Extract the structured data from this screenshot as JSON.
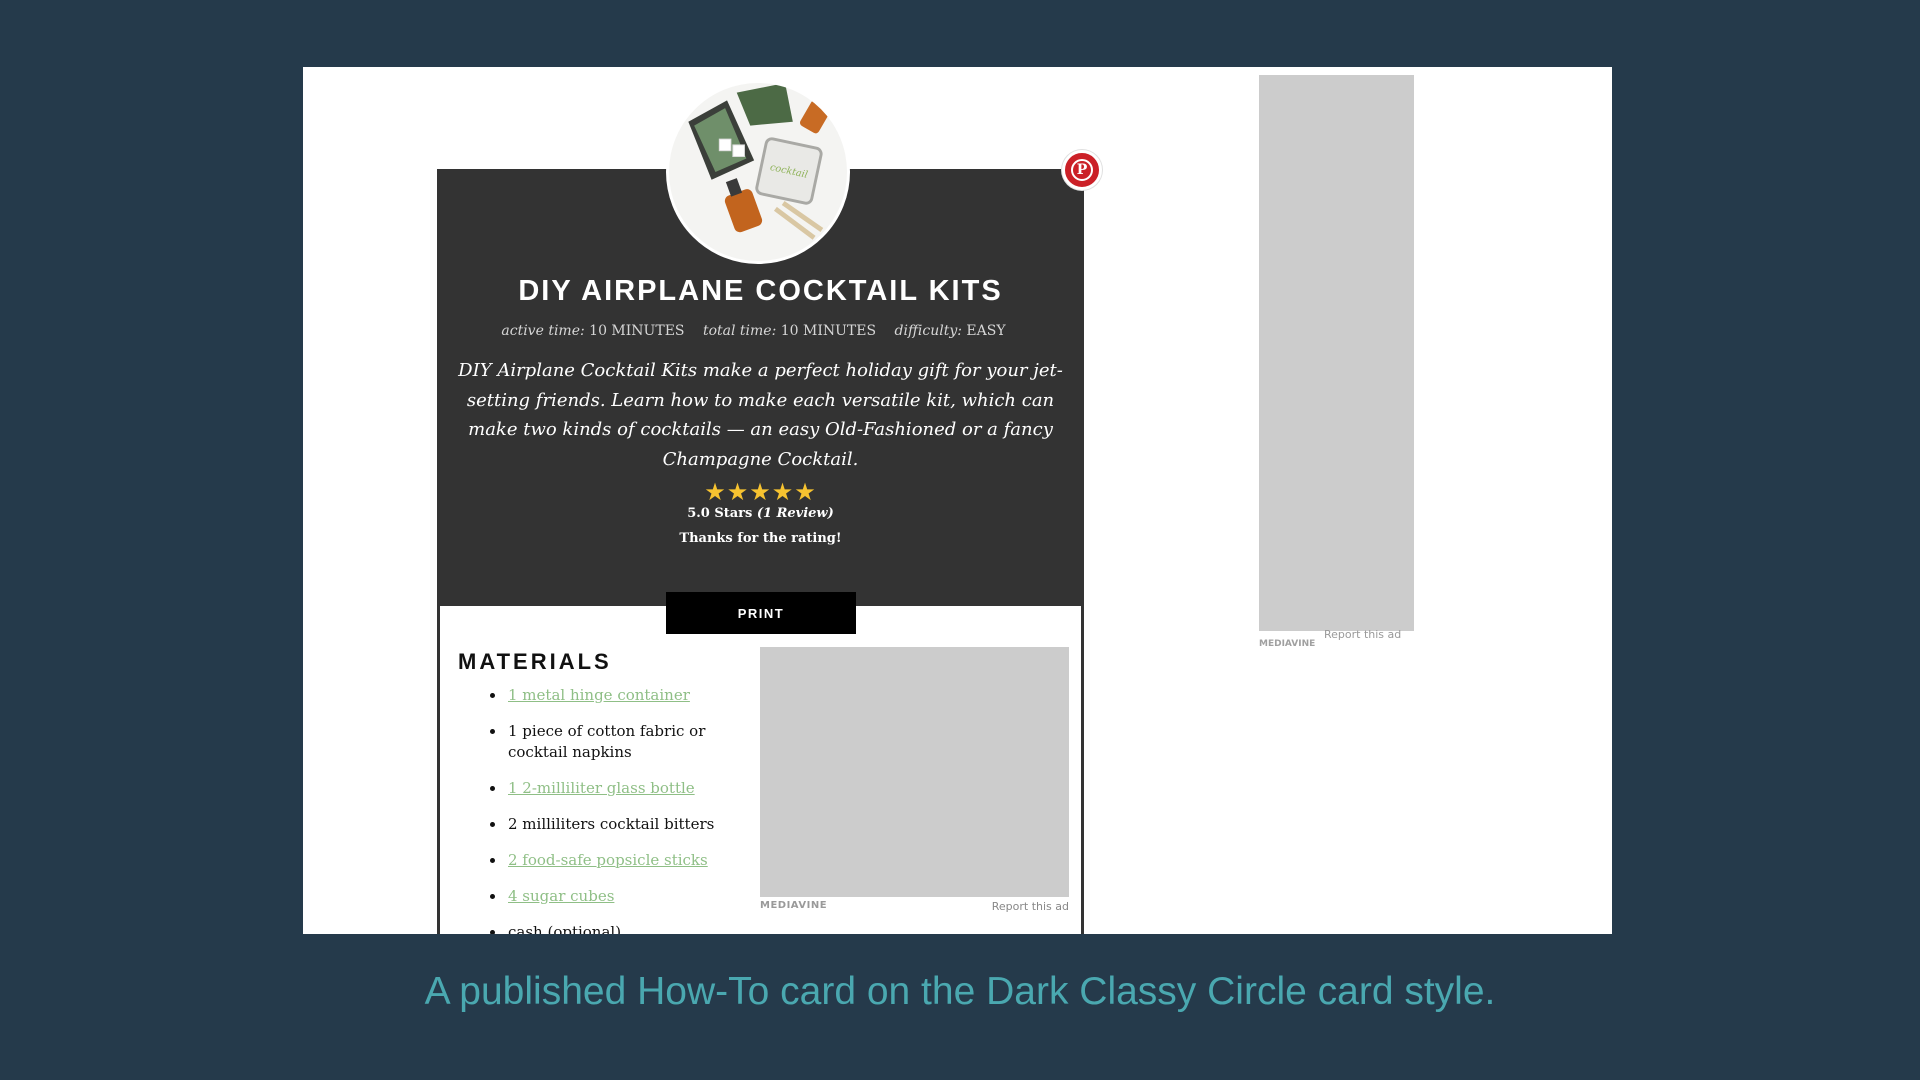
{
  "card": {
    "title": "DIY AIRPLANE COCKTAIL KITS",
    "meta": {
      "active_label": "active time:",
      "active_value": "10 MINUTES",
      "total_label": "total time:",
      "total_value": "10 MINUTES",
      "difficulty_label": "difficulty:",
      "difficulty_value": "EASY"
    },
    "summary": "DIY Airplane Cocktail Kits make a perfect holiday gift for your jet-setting friends. Learn how to make each versatile kit, which can make two kinds of cocktails — an easy Old-Fashioned or a fancy Champagne Cocktail.",
    "stars": "★★★★★",
    "rating": 5,
    "rating_text": "5.0 Stars",
    "review_count": "(1 Review)",
    "thanks": "Thanks for the rating!",
    "print_label": "PRINT",
    "materials_heading": "MATERIALS",
    "materials": [
      {
        "text": "1 metal hinge container",
        "link": true
      },
      {
        "text": "1 piece of cotton fabric or cocktail napkins",
        "link": false
      },
      {
        "text": "1 2-milliliter glass bottle",
        "link": true
      },
      {
        "text": "2 milliliters cocktail bitters",
        "link": false
      },
      {
        "text": "2 food-safe popsicle sticks",
        "link": true
      },
      {
        "text": "4 sugar cubes",
        "link": true
      },
      {
        "text": "cash (optional)",
        "link": false
      }
    ],
    "pin_icon": "pinterest-icon"
  },
  "ads": {
    "inline_brand": "MEDIAVINE",
    "inline_report": "Report this ad",
    "side_report": "Report this ad",
    "side_brand": "MEDIAVINE"
  },
  "caption": "A published How-To card on the Dark Classy Circle card style.",
  "colors": {
    "background": "#253a4b",
    "card_dark": "#333333",
    "star": "#f7c330",
    "link": "#8fbf86",
    "caption": "#4aa8b0",
    "pinterest": "#cb2027"
  }
}
